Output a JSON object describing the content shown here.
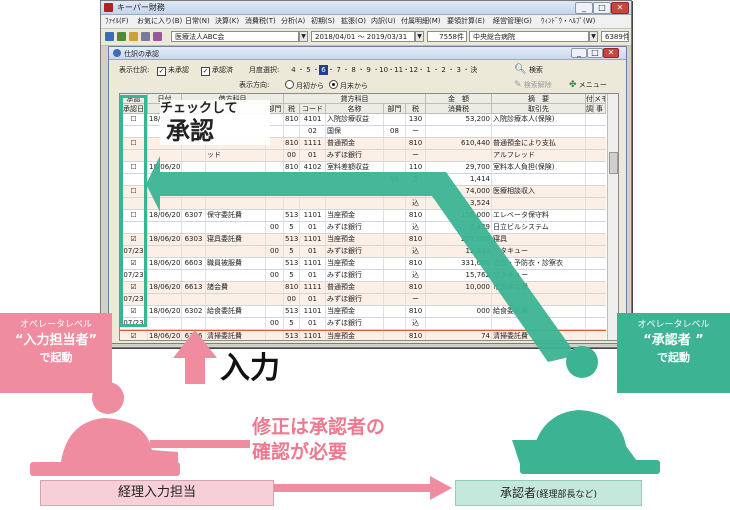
{
  "app": {
    "title": "キーパー財務",
    "menus": [
      "ﾌｧｲﾙ(F)",
      "お気に入り(B)",
      "日常(N)",
      "決算(K)",
      "消費税(T)",
      "分析(A)",
      "初期(S)",
      "拡張(O)",
      "内訳(U)",
      "付属明細(M)",
      "要領計算(E)",
      "経営管理(G)",
      "ｳｨﾝﾄﾞｳ・ﾍﾙﾌﾟ(W)"
    ],
    "company": "医療法人ABC会",
    "period": "2018/04/01 ～ 2019/03/31",
    "count_label": "7558件",
    "office": "中央総合病院",
    "record_count": "6389件"
  },
  "journal": {
    "title": "仕訳の承認",
    "display_filter_label": "表示仕訳:",
    "filter_unapproved": "未承認",
    "filter_approved": "承認済",
    "month_select_label": "月度選択:",
    "months": [
      "4",
      "5",
      "6",
      "7",
      "8",
      "9",
      "10",
      "11",
      "12",
      "1",
      "2",
      "3",
      "決"
    ],
    "selected_month": "6",
    "direction_label": "表示方向:",
    "dir_month_start": "月初から",
    "dir_month_end": "月末から",
    "search_button": "検索",
    "search_clear_button": "検索解除",
    "menu_button": "メニュー"
  },
  "grid": {
    "headers": {
      "approval_group": "承認",
      "approval_date": "承認日",
      "date": "日付",
      "debit_group": "借方科目",
      "credit_group": "貸方科目",
      "code": "コード",
      "name": "名称",
      "dept": "部門",
      "tax": "税",
      "amount_group": "金　額",
      "consumption_tax": "消費税",
      "summary_group": "摘　要",
      "partner": "取引先",
      "attach": "付",
      "attach2": "調",
      "memo": "メモ",
      "memo2": "事"
    },
    "rows": [
      {
        "check": "☐",
        "date": "18/06/20",
        "d_code": "",
        "d_name": "",
        "d_dept": "",
        "c_sub": "810",
        "c_code": "4101",
        "c_name": "入院診療収益",
        "c_dept": "",
        "tax": "130",
        "amount": "53,200",
        "summary": "入院診療本人(保険)",
        "shade": false
      },
      {
        "check": "",
        "date": "",
        "d_code": "",
        "d_name": "",
        "d_dept": "",
        "c_sub": "",
        "c_code": "02",
        "c_name": "国保",
        "c_dept": "08",
        "tax": "ー",
        "amount": "",
        "summary": "",
        "shade": false
      },
      {
        "check": "☐",
        "date": "",
        "d_code": "",
        "d_name": "",
        "d_dept": "",
        "c_sub": "810",
        "c_code": "1111",
        "c_name": "普通預金",
        "c_dept": "",
        "tax": "810",
        "amount": "610,440",
        "summary": "普通預金により支払",
        "shade": true
      },
      {
        "check": "",
        "date": "",
        "d_code": "",
        "d_name": "ッド",
        "d_dept": "",
        "c_sub": "00",
        "c_code": "01",
        "c_name": "みずほ銀行",
        "c_dept": "",
        "tax": "ー",
        "amount": "",
        "summary": "アルフレッド",
        "shade": true
      },
      {
        "check": "☐",
        "date": "18/06/20",
        "d_code": "",
        "d_name": "",
        "d_dept": "",
        "c_sub": "810",
        "c_code": "4102",
        "c_name": "室料差額収益",
        "c_dept": "",
        "tax": "110",
        "amount": "29,700",
        "summary": "室料本人負担(保険)",
        "shade": false
      },
      {
        "check": "",
        "date": "",
        "d_code": "",
        "d_name": "",
        "d_dept": "",
        "c_sub": "",
        "c_code": "",
        "c_name": "",
        "c_dept": "06",
        "tax": "5",
        "amount": "1,414",
        "summary": "",
        "shade": false
      },
      {
        "check": "☐",
        "date": "",
        "d_code": "",
        "d_name": "",
        "d_dept": "",
        "c_sub": "",
        "c_code": "",
        "c_name": "",
        "c_dept": "",
        "tax": "",
        "amount": "74,000",
        "summary": "医療相談収入",
        "shade": true
      },
      {
        "check": "",
        "date": "",
        "d_code": "",
        "d_name": "",
        "d_dept": "",
        "c_sub": "",
        "c_code": "",
        "c_name": "",
        "c_dept": "",
        "tax": "込",
        "amount": "3,524",
        "summary": "",
        "shade": true
      },
      {
        "check": "☐",
        "date": "18/06/20",
        "d_code": "6307",
        "d_name": "保守委託費",
        "d_dept": "",
        "c_sub": "513",
        "c_code": "1101",
        "c_name": "当座預金",
        "c_dept": "",
        "tax": "810",
        "amount": "156,000",
        "summary": "エレベータ保守料",
        "shade": false
      },
      {
        "check": "",
        "date": "",
        "d_code": "",
        "d_name": "",
        "d_dept": "00",
        "c_sub": "5",
        "c_code": "01",
        "c_name": "みずほ銀行",
        "c_dept": "",
        "tax": "込",
        "amount": "7,429",
        "summary": "日立ビルシステム",
        "shade": false
      },
      {
        "check": "☑",
        "date": "18/06/20",
        "d_code": "6303",
        "d_name": "寝具委託費",
        "d_dept": "",
        "c_sub": "513",
        "c_code": "1101",
        "c_name": "当座預金",
        "c_dept": "",
        "tax": "810",
        "amount": "259,000",
        "summary": "寝具",
        "shade": true
      },
      {
        "check": "07/23",
        "date": "",
        "d_code": "",
        "d_name": "",
        "d_dept": "00",
        "c_sub": "5",
        "c_code": "01",
        "c_name": "みずほ銀行",
        "c_dept": "",
        "tax": "込",
        "amount": "12,333",
        "summary": "ワタキュー",
        "shade": true
      },
      {
        "check": "☑",
        "date": "18/06/20",
        "d_code": "6603",
        "d_name": "職員被服費",
        "d_dept": "",
        "c_sub": "513",
        "c_code": "1101",
        "c_name": "当座預金",
        "c_dept": "",
        "tax": "810",
        "amount": "331,000",
        "summary": "白衣・予防衣・診察衣",
        "shade": false
      },
      {
        "check": "07/23",
        "date": "",
        "d_code": "",
        "d_name": "",
        "d_dept": "00",
        "c_sub": "5",
        "c_code": "01",
        "c_name": "みずほ銀行",
        "c_dept": "",
        "tax": "込",
        "amount": "15,762",
        "summary": "ワタキュー",
        "shade": false
      },
      {
        "check": "☑",
        "date": "18/06/20",
        "d_code": "6613",
        "d_name": "諸会費",
        "d_dept": "",
        "c_sub": "810",
        "c_code": "1111",
        "c_name": "普通預金",
        "c_dept": "",
        "tax": "810",
        "amount": "10,000",
        "summary": "市医師会費",
        "shade": true
      },
      {
        "check": "07/23",
        "date": "",
        "d_code": "",
        "d_name": "",
        "d_dept": "",
        "c_sub": "00",
        "c_code": "01",
        "c_name": "みずほ銀行",
        "c_dept": "",
        "tax": "ー",
        "amount": "",
        "summary": "",
        "shade": true
      },
      {
        "check": "☑",
        "date": "18/06/20",
        "d_code": "6302",
        "d_name": "給食委託費",
        "d_dept": "",
        "c_sub": "513",
        "c_code": "1101",
        "c_name": "当座預金",
        "c_dept": "",
        "tax": "810",
        "amount": "000",
        "summary": "給食委託費",
        "shade": false
      },
      {
        "check": "07/23",
        "date": "",
        "d_code": "",
        "d_name": "",
        "d_dept": "00",
        "c_sub": "5",
        "c_code": "01",
        "c_name": "みずほ銀行",
        "c_dept": "",
        "tax": "込",
        "amount": "",
        "summary": "",
        "shade": false
      },
      {
        "check": "☑",
        "date": "18/06/20",
        "d_code": "6306",
        "d_name": "清掃委託費",
        "d_dept": "",
        "c_sub": "513",
        "c_code": "1101",
        "c_name": "当座預金",
        "c_dept": "",
        "tax": "810",
        "amount": "74",
        "summary": "清掃委託費",
        "shade": true
      },
      {
        "check": "07/23",
        "date": "",
        "d_code": "",
        "d_name": "",
        "d_dept": "00",
        "c_sub": "5",
        "c_code": "01",
        "c_name": "みずほ銀行",
        "c_dept": "",
        "tax": "込",
        "amount": "",
        "summary": "",
        "shade": true
      }
    ]
  },
  "overlay": {
    "check_line1": "チェックして",
    "check_line2": "承認",
    "oper_input_small": "オペレータレベル",
    "oper_input_big": "“入力担当者”",
    "oper_input_tail": "で起動",
    "oper_approver_small": "オペレータレベル",
    "oper_approver_big": "“承認者 ”",
    "oper_approver_tail": "で起動",
    "input_label": "入力",
    "correction_line1": "修正は承認者の",
    "correction_line2": "確認が必要",
    "bottom_left": "経理入力担当",
    "bottom_right_main": "承認者",
    "bottom_right_sub": "(経理部長など)"
  },
  "colors": {
    "green": "#3cb494",
    "pink": "#f08ca0",
    "pink_light": "#f7cfd7",
    "green_light": "#c5e8dd"
  }
}
